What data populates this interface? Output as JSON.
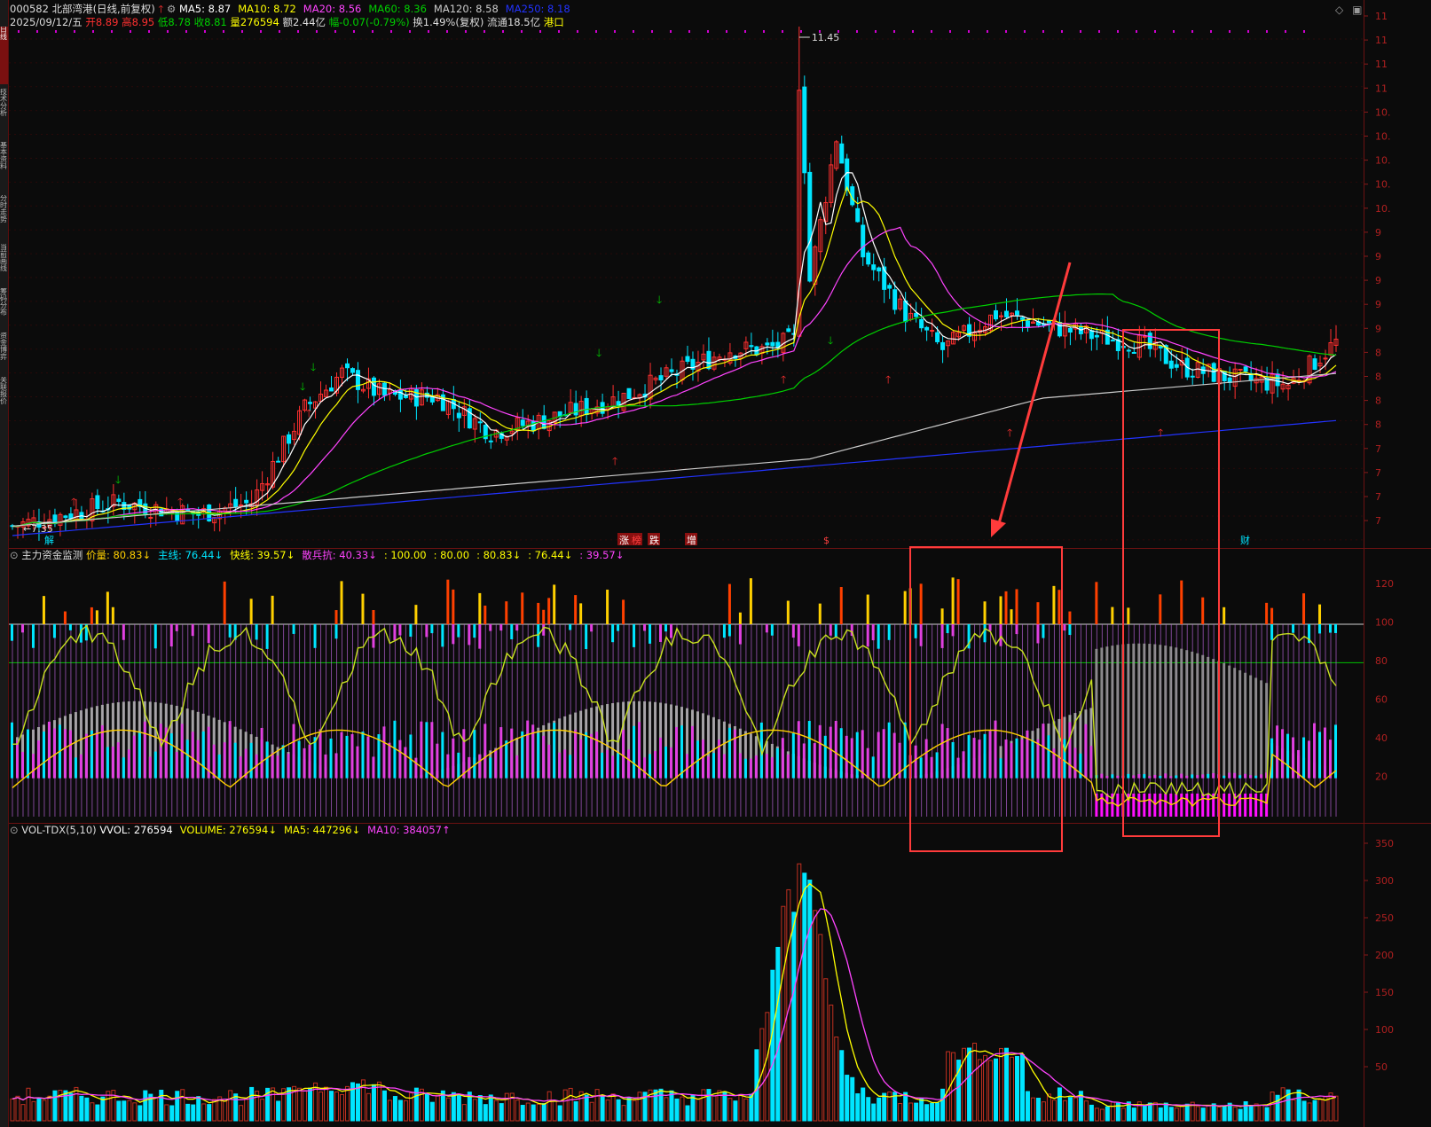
{
  "left_sidebar": {
    "items": [
      "日线",
      "技术分析",
      "基本资料",
      "分时走势",
      "当前画线",
      "筹码分布",
      "资金博弈",
      "关联报价"
    ]
  },
  "main": {
    "code": "000582",
    "name": "北部湾港",
    "period": "(日线,前复权)",
    "ma": [
      {
        "label": "MA5: 8.87",
        "color": "#ffffff"
      },
      {
        "label": "MA10: 8.72",
        "color": "#ffff00"
      },
      {
        "label": "MA20: 8.56",
        "color": "#ff44ff"
      },
      {
        "label": "MA60: 8.36",
        "color": "#00d000"
      },
      {
        "label": "MA120: 8.58",
        "color": "#cccccc"
      },
      {
        "label": "MA250: 8.18",
        "color": "#2233ff"
      }
    ],
    "date": "2025/09/12/五",
    "open_label": "开",
    "open_value": "8.89",
    "high_label": "高",
    "high_value": "8.95",
    "low_label": "低",
    "low_value": "8.78",
    "close_label": "收",
    "close_value": "8.81",
    "volume": "量276594",
    "amount": "额2.44亿",
    "change": "幅-0.07(-0.79%)",
    "turnover": "换1.49%(复权)",
    "float_cap": "流通18.5亿",
    "sector": "港口",
    "high_marker": "11.45",
    "low_marker": "7.35",
    "event_labels": [
      "解",
      "涨",
      "榜",
      "跌",
      "增",
      "$",
      "财"
    ],
    "y_axis": [
      "11",
      "11",
      "11",
      "11",
      "10.",
      "10.",
      "10.",
      "10.",
      "10.",
      "9",
      "9",
      "9",
      "9",
      "9",
      "8",
      "8",
      "8",
      "8",
      "7",
      "7",
      "7",
      "7"
    ]
  },
  "indicator": {
    "name": "主力资金监测",
    "items": [
      {
        "label": "价量: 80.83↓",
        "color": "#ffd000"
      },
      {
        "label": "主线: 76.44↓",
        "color": "#00e5ff"
      },
      {
        "label": "快线: 39.57↓",
        "color": "#ffff00"
      },
      {
        "label": "散兵抗: 40.33↓",
        "color": "#ff44ff"
      },
      {
        "label": ": 100.00",
        "color": "#ffff00"
      },
      {
        "label": ": 80.00",
        "color": "#ffff00"
      },
      {
        "label": ": 80.83↓",
        "color": "#ffff00"
      },
      {
        "label": ": 76.44↓",
        "color": "#ffff00"
      },
      {
        "label": ": 39.57↓",
        "color": "#ff44ff"
      }
    ],
    "y_axis": [
      "120",
      "100",
      "80",
      "60",
      "40",
      "20"
    ]
  },
  "volume_panel": {
    "name": "VOL-TDX(5,10)",
    "items": [
      {
        "label": "VVOL: 276594",
        "color": "#ffffff"
      },
      {
        "label": "VOLUME: 276594↓",
        "color": "#ffff00"
      },
      {
        "label": "MA5: 447296↓",
        "color": "#ffff00"
      },
      {
        "label": "MA10: 384057↑",
        "color": "#ff44ff"
      }
    ],
    "y_axis": [
      "350",
      "300",
      "250",
      "200",
      "150",
      "100",
      "50"
    ]
  },
  "colors": {
    "up": "#ff3030",
    "down": "#00e5ff",
    "border": "#6b1212",
    "highlight_box": "#ff3b3b"
  }
}
